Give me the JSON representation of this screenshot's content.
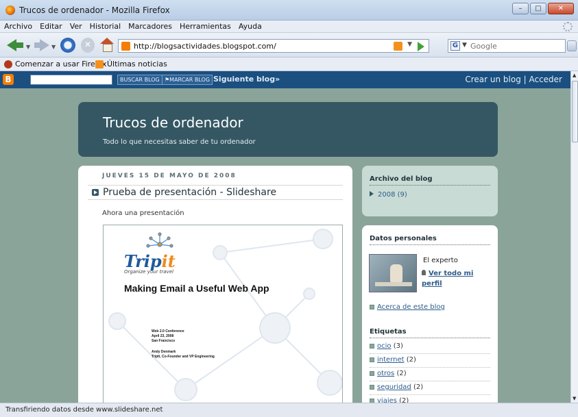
{
  "window": {
    "title": "Trucos de ordenador - Mozilla Firefox",
    "minimize": "–",
    "maximize": "□",
    "close": "✕"
  },
  "menu": [
    "Archivo",
    "Editar",
    "Ver",
    "Historial",
    "Marcadores",
    "Herramientas",
    "Ayuda"
  ],
  "navigation": {
    "url": "http://blogsactividades.blogspot.com/",
    "search_placeholder": "Google"
  },
  "bookmarks": {
    "first": "Comenzar a usar Firefox",
    "second": "Últimas noticias"
  },
  "blogger_bar": {
    "logo": "B",
    "search_button": "BUSCAR BLOG",
    "flag_button": "⚑MARCAR BLOG",
    "next_blog": "Siguiente blog»",
    "right_links": "Crear un blog | Acceder"
  },
  "blog": {
    "title": "Trucos de ordenador",
    "description": "Todo lo que necesitas saber de tu ordenador"
  },
  "post": {
    "date": "JUEVES 15 DE MAYO DE 2008",
    "title": "Prueba de presentación - Slideshare",
    "intro": "Ahora una presentación",
    "slide": {
      "logo_main": "Trip",
      "logo_accent": "it",
      "tagline": "Organize your travel",
      "heading": "Making Email a Useful Web App",
      "conference": [
        "Web 2.0 Conference",
        "April 23, 2008",
        "San Francisco"
      ],
      "author": [
        "Andy Denmark",
        "TripIt, Co-Founder and VP Engineering"
      ]
    }
  },
  "archive": {
    "heading": "Archivo del blog",
    "item": "2008",
    "count": "(9)"
  },
  "profile": {
    "heading": "Datos personales",
    "name": "El experto",
    "view_profile": "Ver todo mi perfil",
    "about": "Acerca de este blog"
  },
  "labels": {
    "heading": "Etiquetas",
    "items": [
      {
        "name": "ocio",
        "count": "(3)"
      },
      {
        "name": "internet",
        "count": "(2)"
      },
      {
        "name": "otros",
        "count": "(2)"
      },
      {
        "name": "seguridad",
        "count": "(2)"
      },
      {
        "name": "viajes",
        "count": "(2)"
      }
    ]
  },
  "status": "Transfiriendo datos desde www.slideshare.net",
  "colors": {
    "page_bg": "#8ba49a",
    "header_bg": "#355764",
    "blogger_bar": "#1a4f80",
    "link": "#2d5b8a"
  }
}
